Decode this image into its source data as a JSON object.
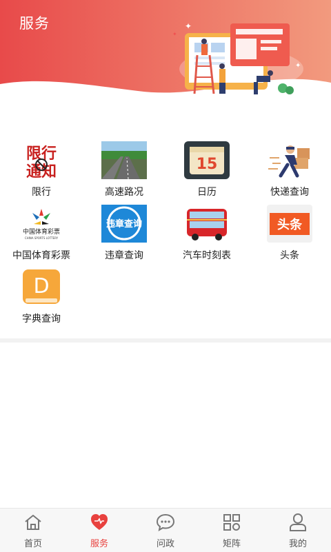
{
  "header": {
    "title": "服务"
  },
  "services": [
    {
      "label": "限行",
      "icon": "traffic-restriction-icon",
      "img_text": [
        "限行",
        "通知"
      ]
    },
    {
      "label": "高速路况",
      "icon": "highway-icon"
    },
    {
      "label": "日历",
      "icon": "calendar-icon",
      "img_text": "15"
    },
    {
      "label": "快递查询",
      "icon": "courier-icon"
    },
    {
      "label": "中国体育彩票",
      "icon": "sports-lottery-icon",
      "img_text": [
        "中国体育彩票",
        "CHINA SPORTS LOTTERY"
      ]
    },
    {
      "label": "违章查询",
      "icon": "violation-query-icon",
      "img_text": "违章查询"
    },
    {
      "label": "汽车时刻表",
      "icon": "bus-icon"
    },
    {
      "label": "头条",
      "icon": "headlines-icon",
      "img_text": "头条"
    },
    {
      "label": "字典查询",
      "icon": "dictionary-icon",
      "img_text": "D"
    }
  ],
  "tabs": [
    {
      "label": "首页",
      "icon": "home-icon",
      "active": false
    },
    {
      "label": "服务",
      "icon": "heart-icon",
      "active": true
    },
    {
      "label": "问政",
      "icon": "chat-icon",
      "active": false
    },
    {
      "label": "矩阵",
      "icon": "grid-icon",
      "active": false
    },
    {
      "label": "我的",
      "icon": "user-icon",
      "active": false
    }
  ],
  "colors": {
    "accent": "#e8413e",
    "header_start": "#e84a4a",
    "header_end": "#f29a7e"
  }
}
